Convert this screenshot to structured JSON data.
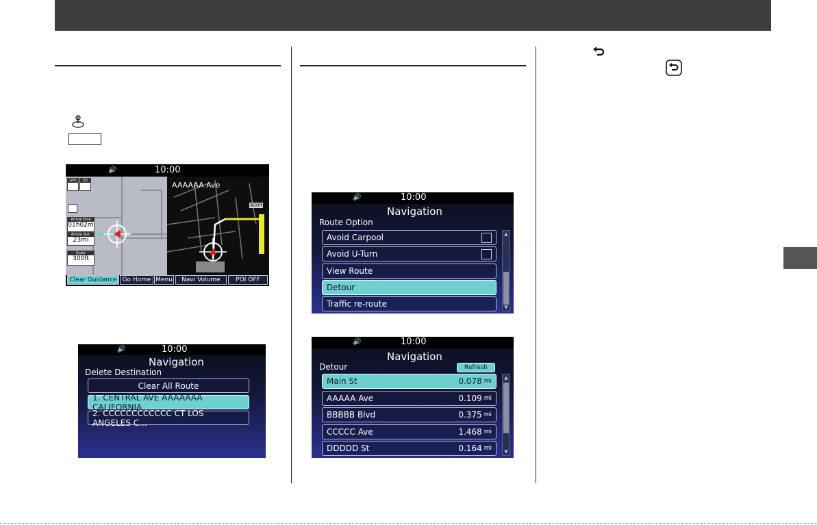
{
  "map_screen": {
    "clock": "10:00",
    "street": "AAAAAA Ave",
    "distance_marker": "800ft",
    "gps_label": "GPS",
    "heading_label": "2D",
    "arrival_time_label": "Arrival time",
    "arrival_time": "01h02m",
    "arrival_dist_label": "Arrival dist.",
    "arrival_dist": "23mi",
    "scale_label": "Scale",
    "scale_value": "300ft",
    "buttons": [
      "Clear Guidance",
      "Go Home",
      "Menu",
      "Navi Volume",
      "POI OFF"
    ]
  },
  "delete_screen": {
    "clock": "10:00",
    "title": "Navigation",
    "subtitle": "Delete Destination",
    "clear_all": "Clear All Route",
    "items": [
      "1.  CENTRAL AVE AAAAAAA CALIFORNIA",
      "2.  CCCCCCCCCCCC CT LOS ANGELES C..."
    ]
  },
  "route_screen": {
    "clock": "10:00",
    "title": "Navigation",
    "subtitle": "Route Option",
    "items": [
      "Avoid Carpool",
      "Avoid U-Turn",
      "View Route",
      "Detour",
      "Traffic re-route"
    ]
  },
  "detour_screen": {
    "clock": "10:00",
    "title": "Navigation",
    "subtitle": "Detour",
    "refresh": "Refresh",
    "unit": "mi",
    "rows": [
      {
        "name": "Main St",
        "dist": "0.078"
      },
      {
        "name": "AAAAA Ave",
        "dist": "0.109"
      },
      {
        "name": "BBBBB Blvd",
        "dist": "0.375"
      },
      {
        "name": "CCCCC Ave",
        "dist": "1.468"
      },
      {
        "name": "DDDDD St",
        "dist": "0.164"
      }
    ]
  },
  "icons": {
    "speaker": "speaker-icon",
    "back": "back-arrow-icon",
    "joystick": "joystick-icon"
  },
  "colors": {
    "header": "#3d3d3d",
    "selected": "#6fd0d0",
    "screen_bg": "#14183a"
  }
}
